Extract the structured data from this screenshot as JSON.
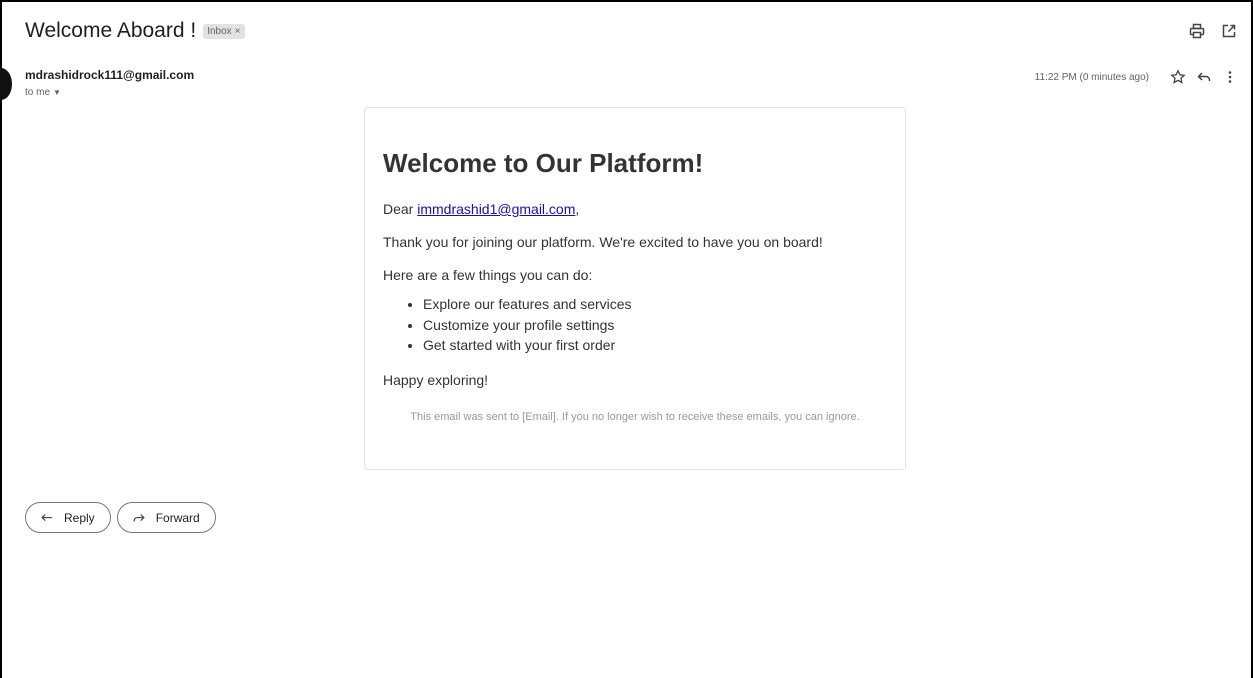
{
  "email": {
    "subject": "Welcome Aboard !",
    "label": "Inbox",
    "label_remove": "×",
    "sender": "mdrashidrock111@gmail.com",
    "recipient": "to me",
    "timestamp": "11:22 PM (0 minutes ago)"
  },
  "body": {
    "heading": "Welcome to Our Platform!",
    "greeting_prefix": "Dear ",
    "greeting_email": "immdrashid1@gmail.com",
    "greeting_suffix": ",",
    "thanks": "Thank you for joining our platform. We're excited to have you on board!",
    "intro": "Here are a few things you can do:",
    "items": [
      "Explore our features and services",
      "Customize your profile settings",
      "Get started with your first order"
    ],
    "closing": "Happy exploring!",
    "footer": "This email was sent to [Email]. If you no longer wish to receive these emails, you can ignore."
  },
  "actions": {
    "reply_label": "Reply",
    "forward_label": "Forward"
  },
  "icons": {
    "print": "print-icon",
    "open_new_window": "open-in-new-window-icon",
    "star": "star-icon",
    "reply": "reply-icon",
    "more": "more-vertical-icon",
    "forward": "forward-icon"
  }
}
